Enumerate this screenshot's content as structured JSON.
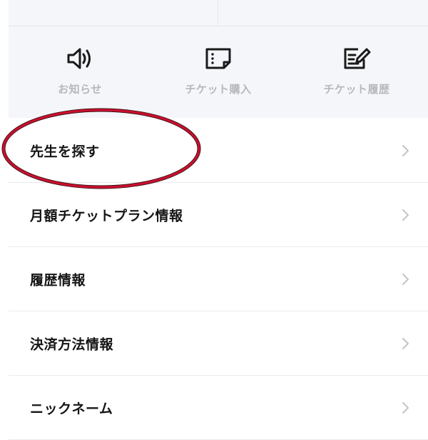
{
  "quick_menu": [
    {
      "label": "お知らせ",
      "icon": "speaker-icon"
    },
    {
      "label": "チケット購入",
      "icon": "ticket-icon"
    },
    {
      "label": "チケット履歴",
      "icon": "edit-note-icon"
    }
  ],
  "menu": [
    {
      "label": "先生を探す"
    },
    {
      "label": "月額チケットプラン情報"
    },
    {
      "label": "履歴情報"
    },
    {
      "label": "決済方法情報"
    },
    {
      "label": "ニックネーム"
    }
  ],
  "colors": {
    "highlight": "#c8102e",
    "header_bg": "#f5f6fa",
    "chevron": "#c4c4c8"
  }
}
